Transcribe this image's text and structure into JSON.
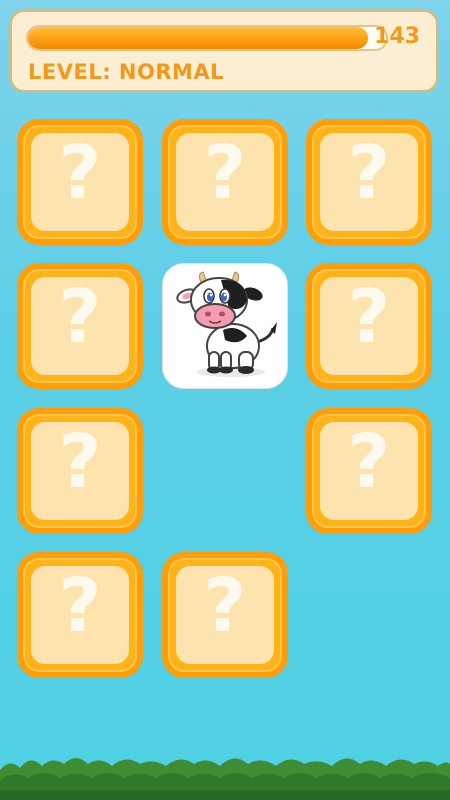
{
  "hud": {
    "timer_value": "143",
    "timer_progress": 0.95,
    "level_label": "LEVEL: NORMAL"
  },
  "cards": [
    {
      "state": "hidden",
      "symbol": "?"
    },
    {
      "state": "hidden",
      "symbol": "?"
    },
    {
      "state": "hidden",
      "symbol": "?"
    },
    {
      "state": "hidden",
      "symbol": "?"
    },
    {
      "state": "revealed",
      "image": "cow"
    },
    {
      "state": "hidden",
      "symbol": "?"
    },
    {
      "state": "hidden",
      "symbol": "?"
    },
    {
      "state": "matched-empty"
    },
    {
      "state": "hidden",
      "symbol": "?"
    },
    {
      "state": "hidden",
      "symbol": "?"
    },
    {
      "state": "hidden",
      "symbol": "?"
    },
    {
      "state": "matched-empty"
    }
  ],
  "colors": {
    "accent": "#f39b16",
    "card_border": "#ff9e0a",
    "card_face": "#fde3ae"
  }
}
